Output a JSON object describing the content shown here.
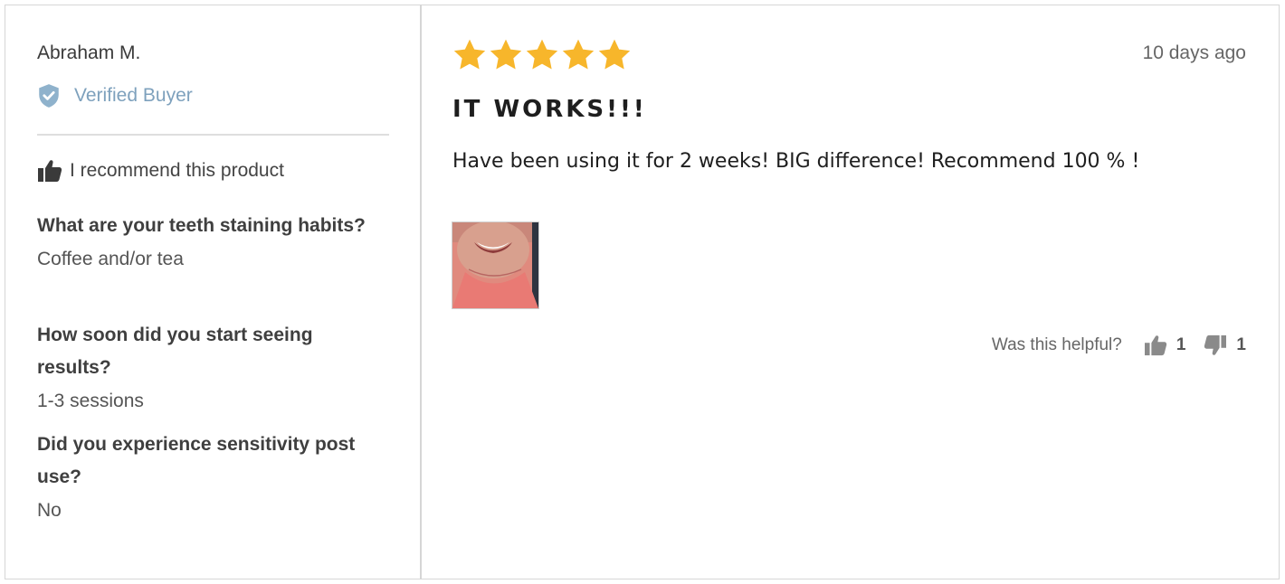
{
  "reviewer": {
    "name": "Abraham M.",
    "verified_label": "Verified Buyer",
    "recommend_label": "I recommend this product"
  },
  "questions": [
    {
      "question": "What are your teeth staining habits?",
      "answer": "Coffee and/or tea"
    },
    {
      "question": "How soon did you start seeing results?",
      "answer": "1-3 sessions"
    },
    {
      "question": "Did you experience sensitivity post use?",
      "answer": "No"
    }
  ],
  "review": {
    "rating": 5,
    "max_rating": 5,
    "date": "10 days ago",
    "title": "IT WORKS!!!",
    "body": "Have been using it for 2 weeks! BIG difference! Recommend 100 % !"
  },
  "helpful": {
    "label": "Was this helpful?",
    "up_count": "1",
    "down_count": "1"
  },
  "colors": {
    "star": "#f7b62b",
    "verified": "#7ea1bd",
    "border": "#d6d6d6"
  },
  "icons": {
    "verified": "shield-check-icon",
    "recommend": "thumbs-up-icon",
    "vote_up": "thumbs-up-icon",
    "vote_down": "thumbs-down-icon",
    "rating": "star-icon"
  }
}
